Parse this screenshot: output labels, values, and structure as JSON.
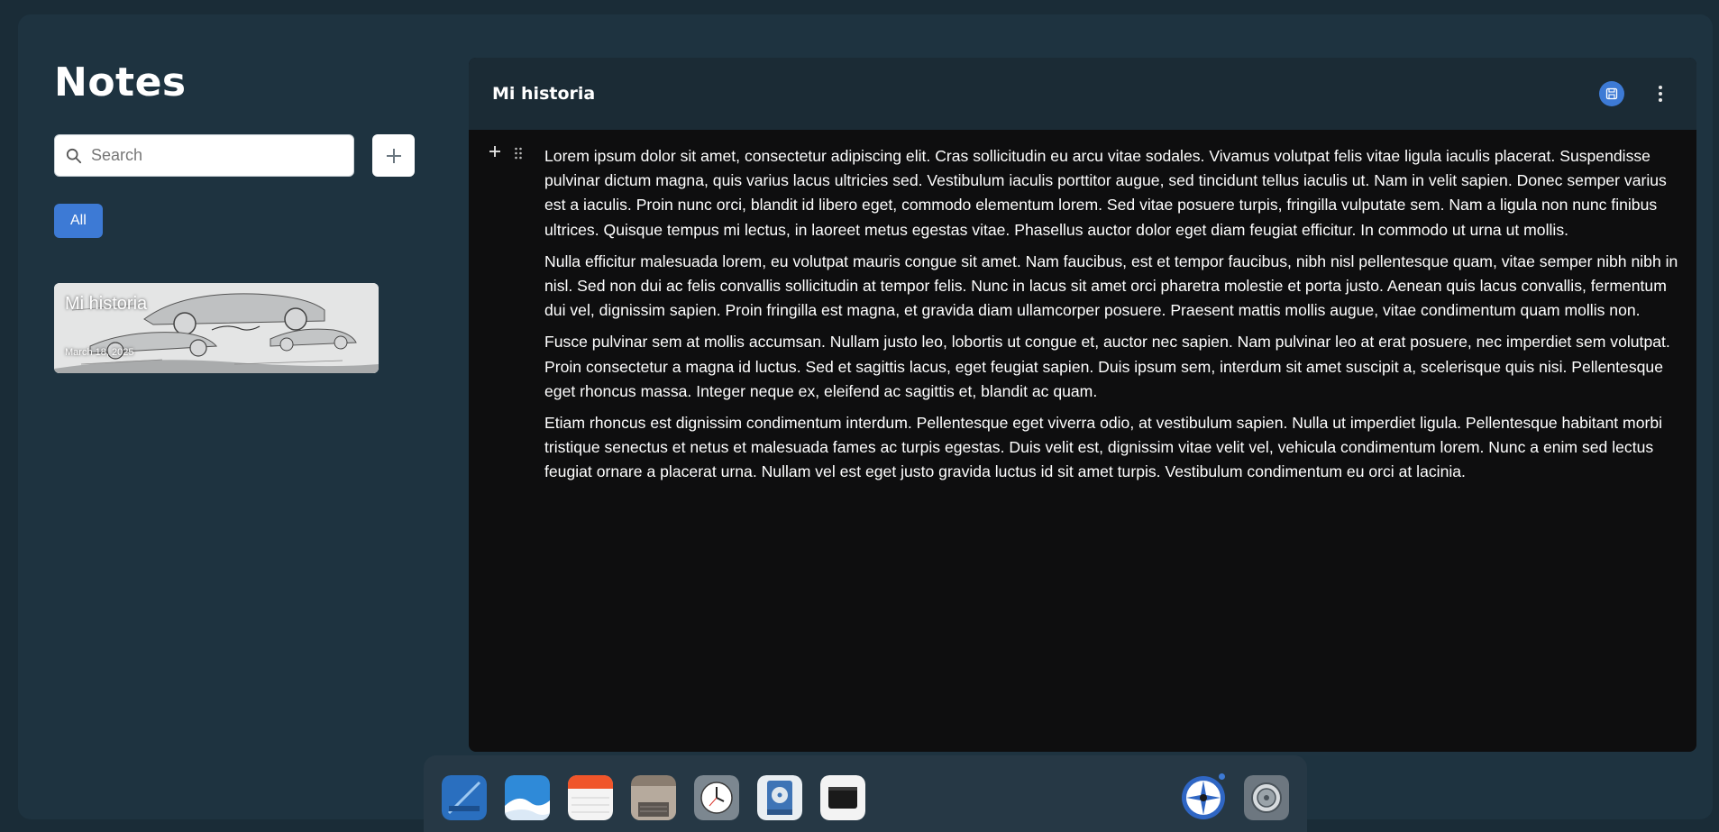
{
  "sidebar": {
    "title": "Notes",
    "search": {
      "placeholder": "Search",
      "value": ""
    },
    "filters": [
      {
        "label": "All",
        "active": true
      }
    ],
    "notes": [
      {
        "title": "Mi historia",
        "date": "March 18, 2025"
      }
    ]
  },
  "editor": {
    "title": "Mi historia",
    "paragraphs": [
      "Lorem ipsum dolor sit amet, consectetur adipiscing elit. Cras sollicitudin eu arcu vitae sodales. Vivamus volutpat felis vitae ligula iaculis placerat. Suspendisse pulvinar dictum magna, quis varius lacus ultricies sed. Vestibulum iaculis porttitor augue, sed tincidunt tellus iaculis ut. Nam in velit sapien. Donec semper varius est a iaculis. Proin nunc orci, blandit id libero eget, commodo elementum lorem. Sed vitae posuere turpis, fringilla vulputate sem. Nam a ligula non nunc finibus ultrices. Quisque tempus mi lectus, in laoreet metus egestas vitae. Phasellus auctor dolor eget diam feugiat efficitur. In commodo ut urna ut mollis.",
      "Nulla efficitur malesuada lorem, eu volutpat mauris congue sit amet. Nam faucibus, est et tempor faucibus, nibh nisl pellentesque quam, vitae semper nibh nibh in nisl. Sed non dui ac felis convallis sollicitudin at tempor felis. Nunc in lacus sit amet orci pharetra molestie et porta justo. Aenean quis lacus convallis, fermentum dui vel, dignissim sapien. Proin fringilla est magna, et gravida diam ullamcorper posuere. Praesent mattis mollis augue, vitae condimentum quam mollis non.",
      "Fusce pulvinar sem at mollis accumsan. Nullam justo leo, lobortis ut congue et, auctor nec sapien. Nam pulvinar leo at erat posuere, nec imperdiet sem volutpat. Proin consectetur a magna id luctus. Sed et sagittis lacus, eget feugiat sapien. Duis ipsum sem, interdum sit amet suscipit a, scelerisque quis nisi. Pellentesque eget rhoncus massa. Integer neque ex, eleifend ac sagittis et, blandit ac quam.",
      "Etiam rhoncus est dignissim condimentum interdum. Pellentesque eget viverra odio, at vestibulum sapien. Nulla ut imperdiet ligula. Pellentesque habitant morbi tristique senectus et netus et malesuada fames ac turpis egestas. Duis velit est, dignissim vitae velit vel, vehicula condimentum lorem. Nunc a enim sed lectus feugiat ornare a placerat urna. Nullam vel est eget justo gravida luctus id sit amet turpis. Vestibulum condimentum eu orci at lacinia."
    ]
  },
  "dock": {
    "apps": [
      "finder-app",
      "cloud-app",
      "notes-app",
      "files-app",
      "clock-app",
      "disk-utility-app",
      "terminal-app",
      "launcher-app",
      "settings-app"
    ]
  },
  "colors": {
    "accent": "#3d7ad5",
    "background": "#1e3340",
    "editor_background": "#0e0e0f",
    "editor_header": "#1b2b35"
  }
}
